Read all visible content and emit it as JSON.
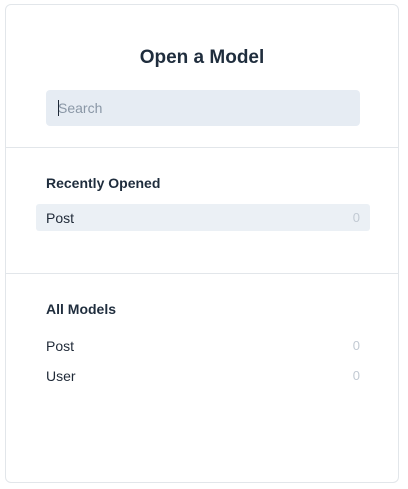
{
  "dialog": {
    "title": "Open a Model"
  },
  "search": {
    "placeholder": "Search",
    "value": ""
  },
  "recent": {
    "heading": "Recently Opened",
    "items": [
      {
        "label": "Post",
        "count": "0"
      }
    ]
  },
  "all_models": {
    "heading": "All Models",
    "items": [
      {
        "label": "Post",
        "count": "0"
      },
      {
        "label": "User",
        "count": "0"
      }
    ]
  },
  "colors": {
    "search_background": "#e6ecf3",
    "active_row_background": "#ebf0f5",
    "count_text": "#c2cad3"
  }
}
